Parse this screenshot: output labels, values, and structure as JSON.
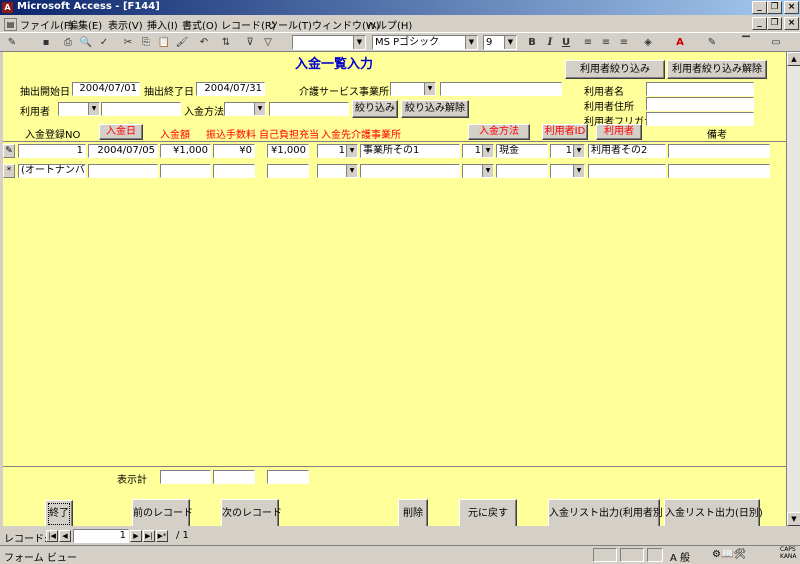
{
  "window": {
    "title": "Microsoft Access - [F144]",
    "minimize": "_",
    "restore": "❐",
    "close": "×"
  },
  "menu": [
    "ファイル(F)",
    "編集(E)",
    "表示(V)",
    "挿入(I)",
    "書式(O)",
    "レコード(R)",
    "ツール(T)",
    "ウィンドウ(W)",
    "ヘルプ(H)"
  ],
  "toolbar": {
    "font_name": "MS Pゴシック",
    "font_size": "9",
    "bold": "B",
    "italic": "I",
    "underline": "U"
  },
  "form": {
    "title": "入金一覧入力",
    "filters": {
      "start_label": "抽出開始日",
      "start_value": "2004/07/01",
      "end_label": "抽出終了日",
      "end_value": "2004/07/31",
      "service_label": "介護サービス事業所",
      "service_value": "",
      "service_text": "",
      "user_label": "利用者",
      "user_value": "",
      "user_text": "",
      "method_label": "入金方法",
      "method_value": "",
      "method_text": "",
      "filter_button": "絞り込み",
      "clear_button": "絞り込み解除"
    },
    "user_filter": {
      "button": "利用者絞り込み",
      "clear_button": "利用者絞り込み解除",
      "name_label": "利用者名",
      "address_label": "利用者住所",
      "kana_label": "利用者フリガナ",
      "name_value": "",
      "address_value": "",
      "kana_value": ""
    },
    "columns": {
      "no": "入金登録NO",
      "date": "入金日",
      "amount": "入金額",
      "fee": "振込手数料",
      "self_pay": "自己負担充当",
      "provider": "入金先介護事業所",
      "method": "入金方法",
      "user_id": "利用者ID",
      "user": "利用者",
      "note": "備考"
    },
    "rows": [
      {
        "selector": "✎",
        "no": "1",
        "date": "2004/07/05",
        "amount": "¥1,000",
        "fee": "¥0",
        "self_pay": "¥1,000",
        "provider_id": "1",
        "provider": "事業所その1",
        "method_id": "1",
        "method": "現金",
        "user_id": "1",
        "user": "利用者その2",
        "note": ""
      }
    ],
    "new_row": {
      "selector": "*",
      "no": "(オートナンバー)"
    },
    "footer": {
      "total_label": "表示計",
      "total_amount": "",
      "total_fee": "",
      "total_self": "",
      "buttons": [
        "終了",
        "前のレコード",
        "次のレコード",
        "削除",
        "元に戻す",
        "入金リスト出力(利用者別)",
        "入金リスト出力(日別)"
      ]
    }
  },
  "nav": {
    "label": "レコード:",
    "current": "1",
    "of": "/ 1"
  },
  "status": {
    "text": "フォーム ビュー",
    "ime": "A 般",
    "caps": "CAPS",
    "kana": "KANA"
  }
}
